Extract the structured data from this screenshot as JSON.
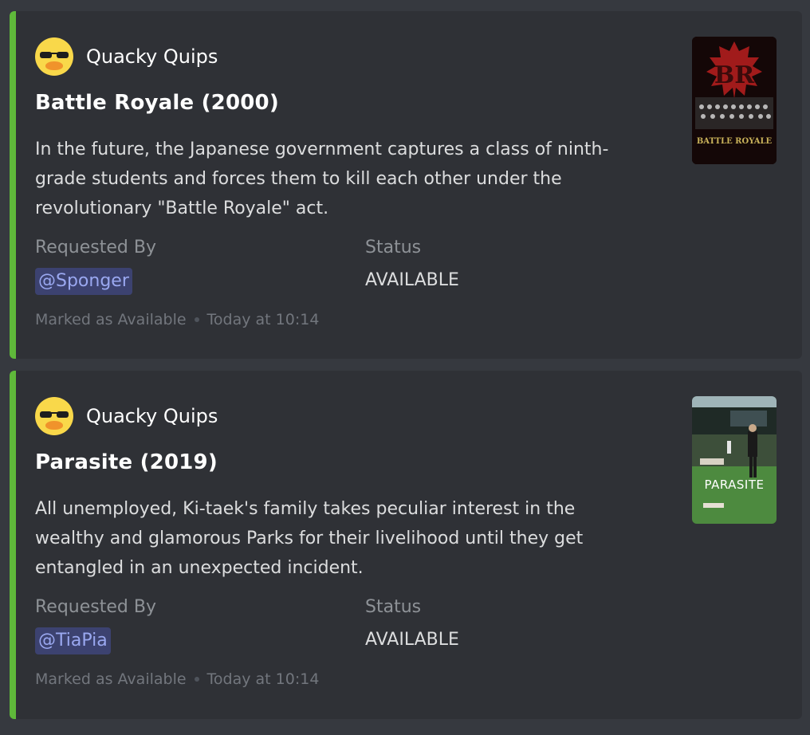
{
  "embeds": [
    {
      "author": "Quacky Quips",
      "title": "Battle Royale (2000)",
      "description": "In the future, the Japanese government captures a class of ninth-grade students and forces them to kill each other under the revolutionary \"Battle Royale\" act.",
      "requested_by_label": "Requested By",
      "requested_by": "@Sponger",
      "status_label": "Status",
      "status": "AVAILABLE",
      "footer_text": "Marked as Available",
      "footer_time": "Today at 10:14",
      "poster_text_main": "BR",
      "poster_text_sub": "BATTLE ROYALE",
      "accent_color": "#5fb83a"
    },
    {
      "author": "Quacky Quips",
      "title": "Parasite (2019)",
      "description": "All unemployed, Ki-taek's family takes peculiar interest in the wealthy and glamorous Parks for their livelihood until they get entangled in an unexpected incident.",
      "requested_by_label": "Requested By",
      "requested_by": "@TiaPia",
      "status_label": "Status",
      "status": "AVAILABLE",
      "footer_text": "Marked as Available",
      "footer_time": "Today at 10:14",
      "poster_text_main": "PARASITE",
      "accent_color": "#5fb83a"
    }
  ],
  "icons": {
    "avatar": "duck-sunglasses-icon"
  }
}
